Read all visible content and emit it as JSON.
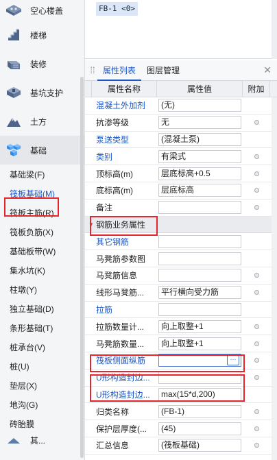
{
  "left_panel": {
    "categories_top": [
      {
        "label": "空心楼盖",
        "icon": "hollow-floor-icon"
      },
      {
        "label": "楼梯",
        "icon": "stairs-icon"
      },
      {
        "label": "装修",
        "icon": "decoration-icon"
      },
      {
        "label": "基坑支护",
        "icon": "pit-support-icon"
      },
      {
        "label": "土方",
        "icon": "earthwork-icon"
      },
      {
        "label": "基础",
        "icon": "foundation-icon"
      }
    ],
    "sub_items": [
      "基础梁(F)",
      "筏板基础(M)",
      "筏板主筋(R)",
      "筏板负筋(X)",
      "基础板带(W)",
      "集水坑(K)",
      "柱墩(Y)",
      "独立基础(D)",
      "条形基础(T)",
      "桩承台(V)",
      "桩(U)",
      "垫层(X)",
      "地沟(G)",
      "砖胎膜"
    ],
    "selected_sub": "筏板基础(M)",
    "bottom_partial": "其..."
  },
  "top_area": {
    "tag": "FB-1 <0>"
  },
  "property_panel": {
    "tabs": [
      "属性列表",
      "图层管理"
    ],
    "active_tab": "属性列表",
    "columns": [
      "属性名称",
      "属性值",
      "附加"
    ],
    "rows_a": [
      {
        "name": "混凝土外加剂",
        "value": "(无)",
        "blue": true,
        "dot": false
      },
      {
        "name": "抗渗等级",
        "value": "无",
        "blue": false,
        "dot": true
      },
      {
        "name": "泵送类型",
        "value": "(混凝土泵)",
        "blue": true,
        "dot": false
      },
      {
        "name": "类别",
        "value": "有梁式",
        "blue": true,
        "dot": true
      },
      {
        "name": "顶标高(m)",
        "value": "层底标高+0.5",
        "blue": false,
        "dot": true
      },
      {
        "name": "底标高(m)",
        "value": "层底标高",
        "blue": false,
        "dot": true
      },
      {
        "name": "备注",
        "value": "",
        "blue": false,
        "dot": true
      }
    ],
    "group_label": "钢筋业务属性",
    "rows_b": [
      {
        "name": "其它钢筋",
        "value": "",
        "blue": true,
        "dot": false
      },
      {
        "name": "马凳筋参数图",
        "value": "",
        "blue": false,
        "dot": false
      },
      {
        "name": "马凳筋信息",
        "value": "",
        "blue": false,
        "dot": true
      },
      {
        "name": "线形马凳筋...",
        "value": "平行横向受力筋",
        "blue": false,
        "dot": true
      },
      {
        "name": "拉筋",
        "value": "",
        "blue": true,
        "dot": false
      },
      {
        "name": "拉筋数量计...",
        "value": "向上取整+1",
        "blue": false,
        "dot": true
      },
      {
        "name": "马凳筋数量...",
        "value": "向上取整+1",
        "blue": false,
        "dot": true
      },
      {
        "name": "筏板侧面纵筋",
        "value": "",
        "blue": true,
        "dot": true,
        "editing": true
      },
      {
        "name": "U形构造封边...",
        "value": "",
        "blue": true,
        "dot": true
      },
      {
        "name": "U形构造封边...",
        "value": "max(15*d,200)",
        "blue": true,
        "dot": false
      },
      {
        "name": "归类名称",
        "value": "(FB-1)",
        "blue": false,
        "dot": true
      },
      {
        "name": "保护层厚度(...",
        "value": "(45)",
        "blue": false,
        "dot": true
      },
      {
        "name": "汇总信息",
        "value": "(筏板基础)",
        "blue": false,
        "dot": true
      }
    ],
    "edit_button": "···"
  },
  "colors": {
    "highlight_red": "#e5242b",
    "link_blue": "#1a55c8"
  }
}
